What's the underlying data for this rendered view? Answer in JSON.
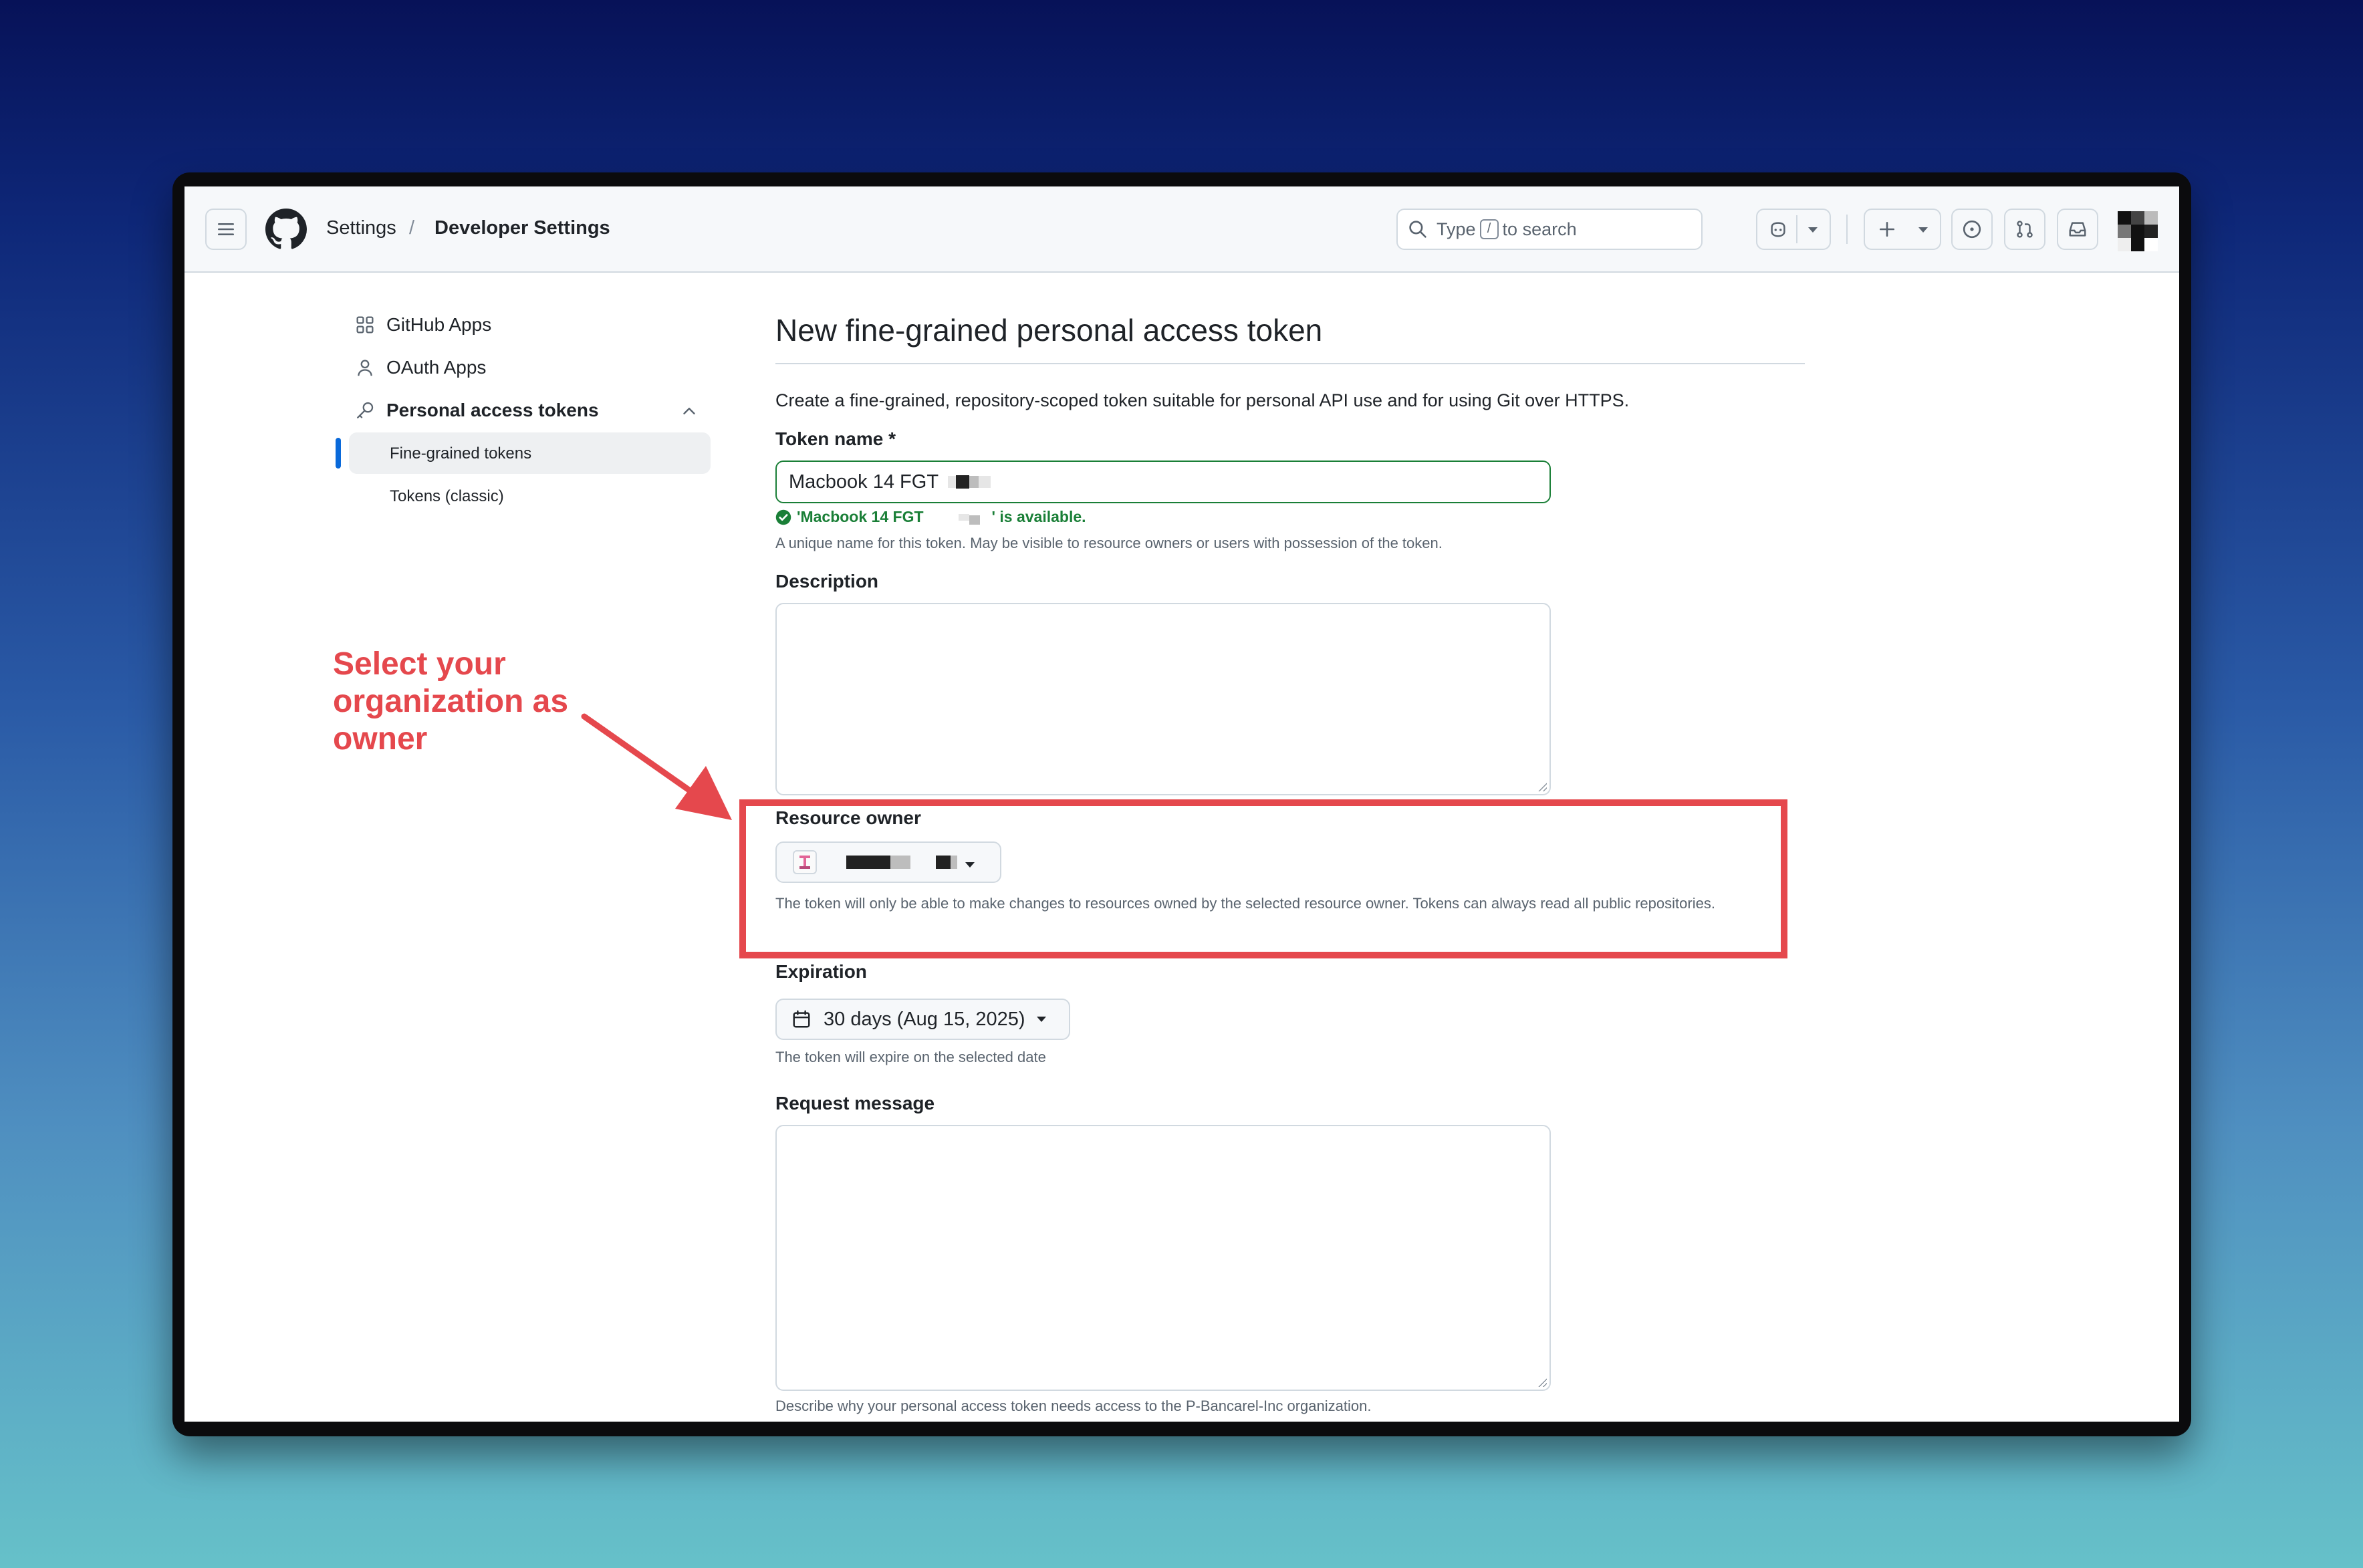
{
  "header": {
    "breadcrumb_root": "Settings",
    "breadcrumb_separator": "/",
    "breadcrumb_current": "Developer Settings",
    "search_prefix": "Type",
    "search_key": "/",
    "search_suffix": "to search"
  },
  "sidebar": {
    "items": [
      {
        "label": "GitHub Apps",
        "icon": "apps-icon"
      },
      {
        "label": "OAuth Apps",
        "icon": "person-icon"
      },
      {
        "label": "Personal access tokens",
        "icon": "key-icon",
        "expanded": true
      }
    ],
    "subitems": [
      {
        "label": "Fine-grained tokens",
        "active": true
      },
      {
        "label": "Tokens (classic)",
        "active": false
      }
    ]
  },
  "main": {
    "title": "New fine-grained personal access token",
    "intro": "Create a fine-grained, repository-scoped token suitable for personal API use and for using Git over HTTPS.",
    "token_name_label": "Token name *",
    "token_name_value": "Macbook 14 FGT",
    "token_available_prefix": "'Macbook 14 FGT",
    "token_available_suffix": "' is available.",
    "token_name_note": "A unique name for this token. May be visible to resource owners or users with possession of the token.",
    "description_label": "Description",
    "resource_owner_label": "Resource owner",
    "resource_owner_note": "The token will only be able to make changes to resources owned by the selected resource owner. Tokens can always read all public repositories.",
    "expiration_label": "Expiration",
    "expiration_value": "30 days (Aug 15, 2025)",
    "expiration_note": "The token will expire on the selected date",
    "request_message_label": "Request message",
    "request_message_note": "Describe why your personal access token needs access to the P-Bancarel-Inc organization."
  },
  "annotation": {
    "text": "Select your organization as owner",
    "color": "#e5484d"
  },
  "colors": {
    "accent": "#0969da",
    "success": "#1a7f37",
    "annotation": "#e5484d"
  }
}
